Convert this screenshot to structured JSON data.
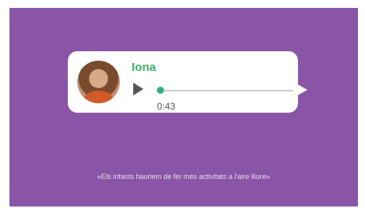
{
  "message": {
    "sender_name": "Iona",
    "audio": {
      "duration": "0:43",
      "progress": 0.0
    }
  },
  "caption": "«Els infants hauriem de fer més activitats a l'aire lliure»",
  "colors": {
    "background": "#8a55a6",
    "bubble": "#ffffff",
    "name": "#3cae6a",
    "progress_knob": "#2fae8a"
  },
  "icons": {
    "play": "play-icon"
  }
}
